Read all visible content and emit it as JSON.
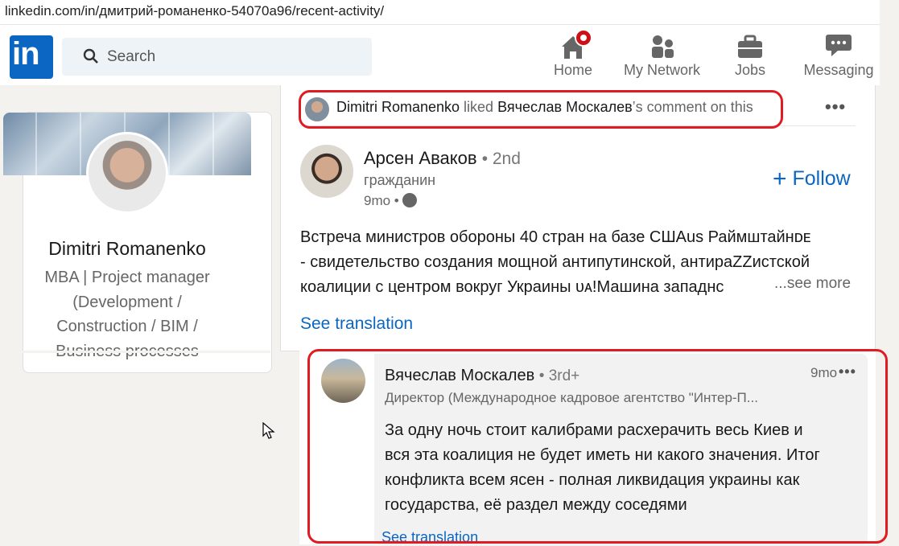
{
  "url": "linkedin.com/in/дмитрий-романенко-54070a96/recent-activity/",
  "search": {
    "placeholder": "Search"
  },
  "nav": [
    {
      "label": "Home",
      "icon": "home-icon"
    },
    {
      "label": "My Network",
      "icon": "people-icon"
    },
    {
      "label": "Jobs",
      "icon": "briefcase-icon"
    },
    {
      "label": "Messaging",
      "icon": "chat-icon"
    }
  ],
  "profile": {
    "name": "Dimitri Romanenko",
    "headline_lines": [
      "MBA | Project manager",
      "(Development /",
      "Construction / BIM /",
      "Business processes"
    ]
  },
  "activity": {
    "actor": "Dimitri Romanenko",
    "verb": " liked ",
    "target": "Вячеслав Москалев",
    "suffix": "’s comment on this"
  },
  "post": {
    "author": "Арсен Аваков",
    "degree": "• 2nd",
    "subtitle": "гражданин",
    "time": "9mo •",
    "follow_label": "Follow",
    "body_lines": [
      "Встреча министров обороны 40 стран на базе СШAus Раймштайнᴅᴇ",
      "- свидетельство создания мощной антипутинской, антираZZистской",
      "коалиции с центром вокруг Украины ᴜᴀ!Машина западнс"
    ],
    "see_more": "...see more",
    "see_translation": "See translation"
  },
  "comment": {
    "author": "Вячеслав Москалев",
    "degree": "• 3rd+",
    "time": "9mo",
    "subtitle": "Директор (Международное кадровое агентство \"Интер-П...",
    "text_lines": [
      "За одну ночь стоит калибрами расхерачить весь Киев и",
      "вся эта коалиция не будет иметь ни какого значения. Итог",
      "конфликта всем ясен - полная ликвидация украины как",
      "государства, её раздел между соседями"
    ],
    "see_translation": "See translation"
  },
  "colors": {
    "accent": "#0a66c2",
    "highlight": "#e01b22",
    "notification": "#cc1016"
  }
}
